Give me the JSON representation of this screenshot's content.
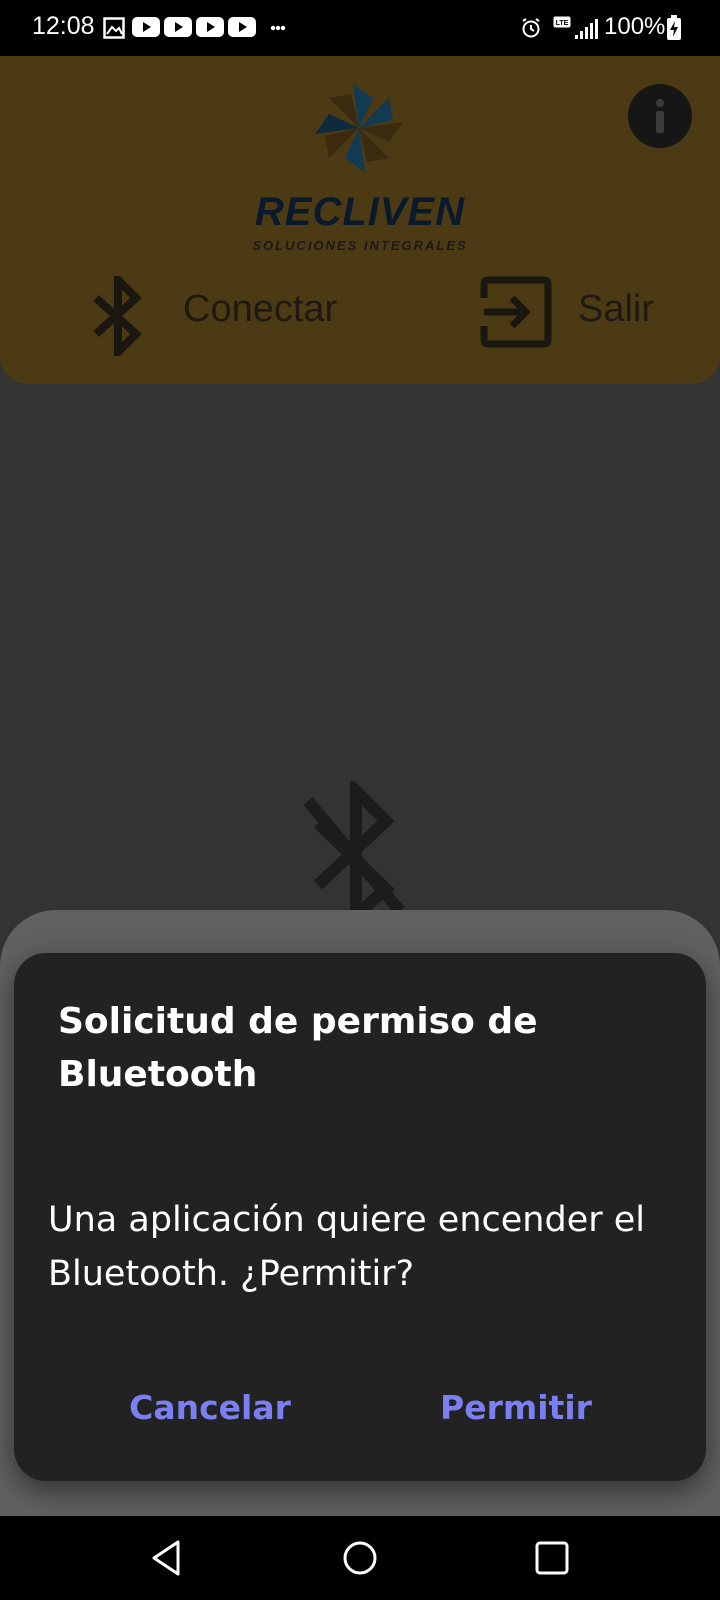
{
  "status_bar": {
    "time": "12:08",
    "battery": "100%",
    "icons": [
      "image-icon",
      "youtube-icon",
      "youtube-icon",
      "youtube-icon",
      "youtube-icon",
      "more-icon",
      "alarm-icon",
      "lte-icon",
      "signal-icon",
      "battery-charging-icon"
    ]
  },
  "app": {
    "logo_name": "RECLIVEN",
    "logo_subtitle": "SOLUCIONES INTEGRALES",
    "connect_label": "Conectar",
    "exit_label": "Salir",
    "header_color": "#4c3a14"
  },
  "dialog": {
    "title": "Solicitud de permiso de Bluetooth",
    "message": "Una aplicación quiere encender el Bluetooth. ¿Permitir?",
    "cancel_label": "Cancelar",
    "allow_label": "Permitir",
    "accent_color": "#7b7ff0"
  },
  "nav_bar": {
    "icons": [
      "back-icon",
      "home-icon",
      "recents-icon"
    ]
  }
}
